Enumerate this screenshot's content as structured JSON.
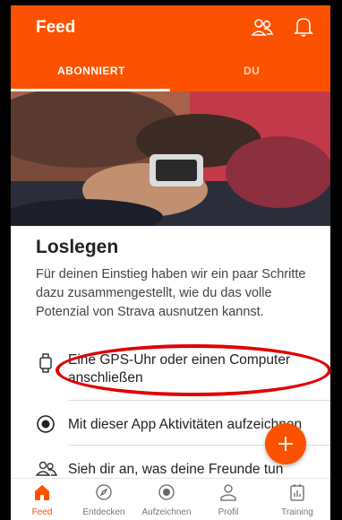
{
  "colors": {
    "accent": "#fc5200",
    "annotation": "#e00000"
  },
  "header": {
    "title": "Feed",
    "friends_icon": "friends-icon",
    "notifications_icon": "bell-icon"
  },
  "tabs": [
    {
      "label": "ABONNIERT",
      "selected": true
    },
    {
      "label": "DU",
      "selected": false
    }
  ],
  "get_started": {
    "title": "Loslegen",
    "description": "Für deinen Einstieg haben wir ein paar Schritte dazu zusammengestellt, wie du das volle Potenzial von Strava ausnutzen kannst.",
    "items": [
      {
        "icon": "watch-icon",
        "label": "Eine GPS-Uhr oder einen Computer anschließen"
      },
      {
        "icon": "record-icon",
        "label": "Mit dieser App Aktivitäten aufzeichnen"
      },
      {
        "icon": "friends-icon",
        "label": "Sieh dir an, was deine Freunde tun"
      }
    ]
  },
  "fab": {
    "icon": "plus-icon"
  },
  "bottom_nav": [
    {
      "label": "Feed",
      "icon": "home-icon",
      "active": true
    },
    {
      "label": "Entdecken",
      "icon": "compass-icon",
      "active": false
    },
    {
      "label": "Aufzeichnen",
      "icon": "record-icon",
      "active": false
    },
    {
      "label": "Profil",
      "icon": "profile-icon",
      "active": false
    },
    {
      "label": "Training",
      "icon": "training-icon",
      "active": false
    }
  ]
}
